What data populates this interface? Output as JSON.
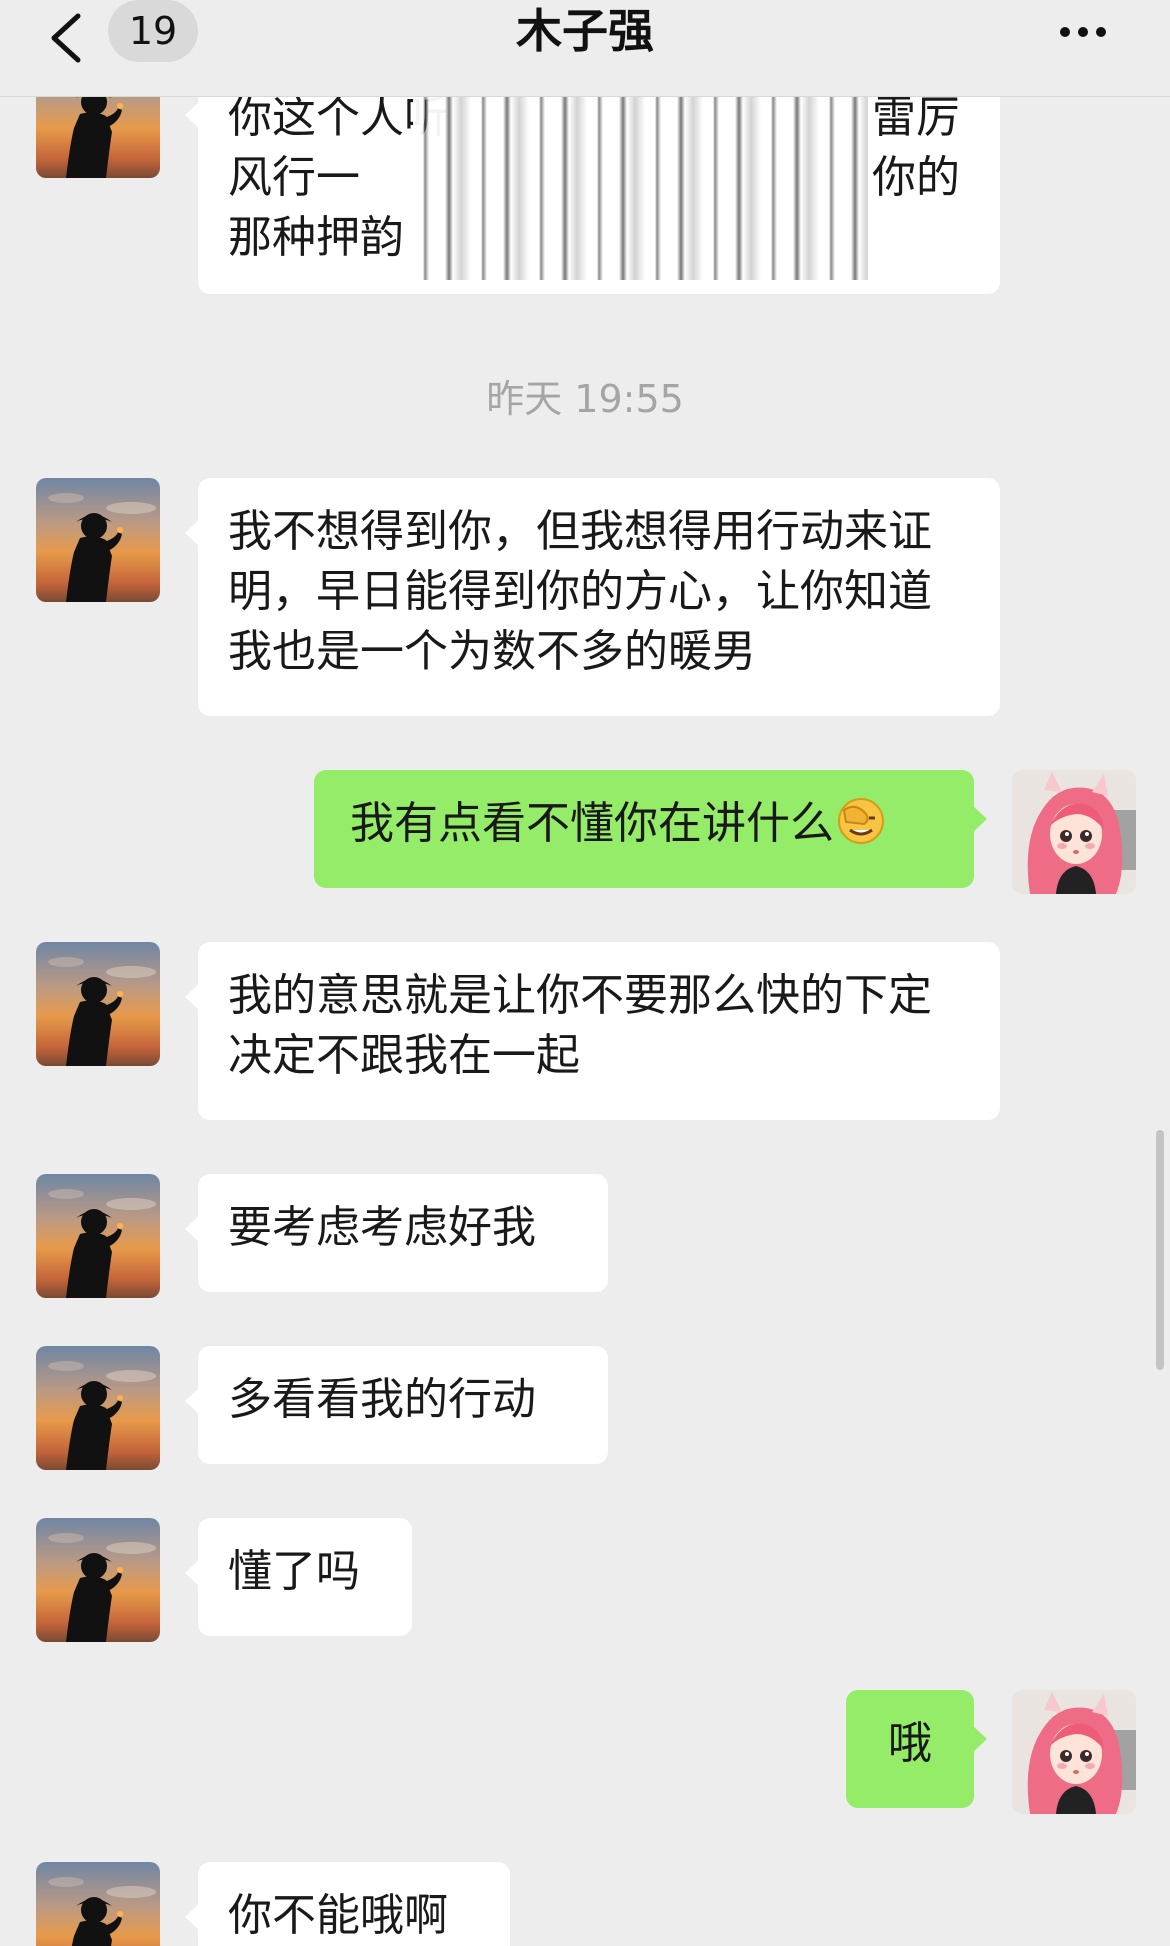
{
  "header": {
    "title": "木子强",
    "unread_count": "19",
    "back_icon": "chevron-left-icon",
    "more_icon": "more-horizontal-icon"
  },
  "messages": {
    "m0": {
      "sender": "contact",
      "text": "你这个人听…十…话…了…雷厉风行一…你的那种押韵…",
      "line1": "你这个人听",
      "line1_end": "雷厉",
      "line2": "风行一",
      "line2_end": "你的",
      "line3": "那种押韵"
    },
    "timestamp": "昨天 19:55",
    "m1": {
      "sender": "contact",
      "text": "我不想得到你，但我想得用行动来证明，早日能得到你的方心，让你知道我也是一个为数不多的暖男"
    },
    "m2": {
      "sender": "me",
      "text": "我有点看不懂你在讲什么",
      "emoji": "facepalm-emoji"
    },
    "m3": {
      "sender": "contact",
      "text": "我的意思就是让你不要那么快的下定决定不跟我在一起"
    },
    "m4": {
      "sender": "contact",
      "text": "要考虑考虑好我"
    },
    "m5": {
      "sender": "contact",
      "text": "多看看我的行动"
    },
    "m6": {
      "sender": "contact",
      "text": "懂了吗"
    },
    "m7": {
      "sender": "me",
      "text": "哦"
    },
    "m8": {
      "sender": "contact",
      "text": "你不能哦啊"
    }
  },
  "colors": {
    "background": "#ededed",
    "incoming_bubble": "#ffffff",
    "outgoing_bubble": "#95ec69",
    "timestamp_text": "#a5a5a5"
  }
}
